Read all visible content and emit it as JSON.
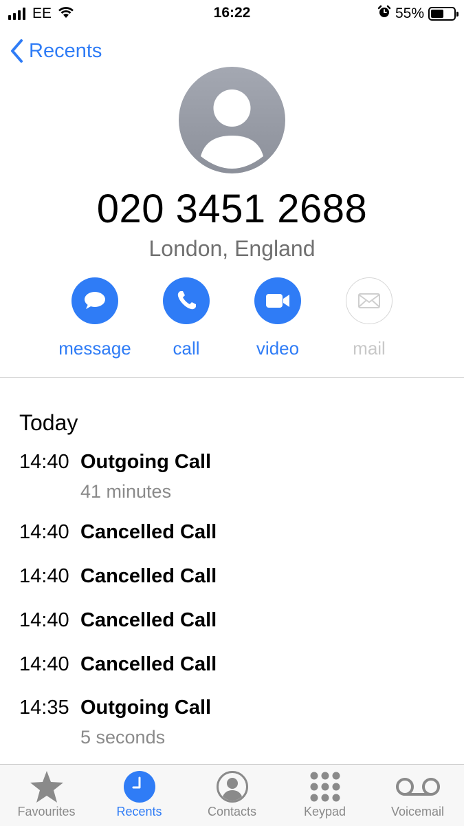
{
  "status_bar": {
    "carrier": "EE",
    "time": "16:22",
    "battery": "55%",
    "battery_level": 0.55,
    "icons": [
      "signal-icon",
      "wifi-icon",
      "alarm-icon",
      "battery-icon"
    ]
  },
  "nav": {
    "back_label": "Recents"
  },
  "contact": {
    "number": "020 3451 2688",
    "location": "London, England"
  },
  "actions": [
    {
      "label": "message",
      "icon": "message-bubble-icon",
      "enabled": true
    },
    {
      "label": "call",
      "icon": "phone-icon",
      "enabled": true
    },
    {
      "label": "video",
      "icon": "video-camera-icon",
      "enabled": true
    },
    {
      "label": "mail",
      "icon": "envelope-icon",
      "enabled": false
    }
  ],
  "call_log": {
    "section_title": "Today",
    "entries": [
      {
        "time": "14:40",
        "type": "Outgoing Call",
        "duration": "41 minutes"
      },
      {
        "time": "14:40",
        "type": "Cancelled Call",
        "duration": ""
      },
      {
        "time": "14:40",
        "type": "Cancelled Call",
        "duration": ""
      },
      {
        "time": "14:40",
        "type": "Cancelled Call",
        "duration": ""
      },
      {
        "time": "14:40",
        "type": "Cancelled Call",
        "duration": ""
      },
      {
        "time": "14:35",
        "type": "Outgoing Call",
        "duration": "5 seconds"
      }
    ]
  },
  "tab_bar": {
    "tabs": [
      {
        "label": "Favourites",
        "icon": "star-icon",
        "active": false
      },
      {
        "label": "Recents",
        "icon": "clock-icon",
        "active": true
      },
      {
        "label": "Contacts",
        "icon": "person-circle-icon",
        "active": false
      },
      {
        "label": "Keypad",
        "icon": "keypad-icon",
        "active": false
      },
      {
        "label": "Voicemail",
        "icon": "voicemail-icon",
        "active": false
      }
    ]
  },
  "colors": {
    "accent": "#2f7cf6",
    "secondary_text": "#8a8a8a",
    "disabled": "#c8c8c8"
  }
}
